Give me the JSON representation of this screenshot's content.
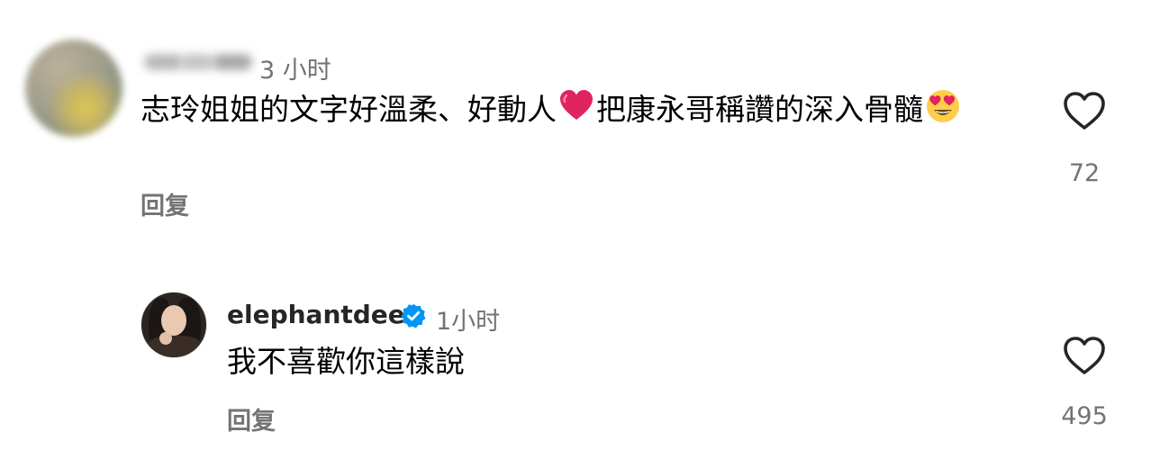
{
  "comments": [
    {
      "username": "",
      "time": "3 小时",
      "text_parts": [
        "志玲姐姐的文字好溫柔、好動人",
        "把康永哥稱讚的深入骨髓"
      ],
      "emojis": [
        "red-heart",
        "heart-eyes-smile"
      ],
      "reply_label": "回复",
      "likes": "72"
    },
    {
      "username": "elephantdee",
      "verified": true,
      "time": "1小时",
      "text": "我不喜歡你這樣說",
      "reply_label": "回复",
      "likes": "495"
    }
  ],
  "icons": {
    "like": "heart-outline-icon",
    "verified": "verified-badge-icon"
  },
  "colors": {
    "meta_gray": "#737373",
    "verified_blue": "#0095f6",
    "heart_red": "#e0245e"
  }
}
